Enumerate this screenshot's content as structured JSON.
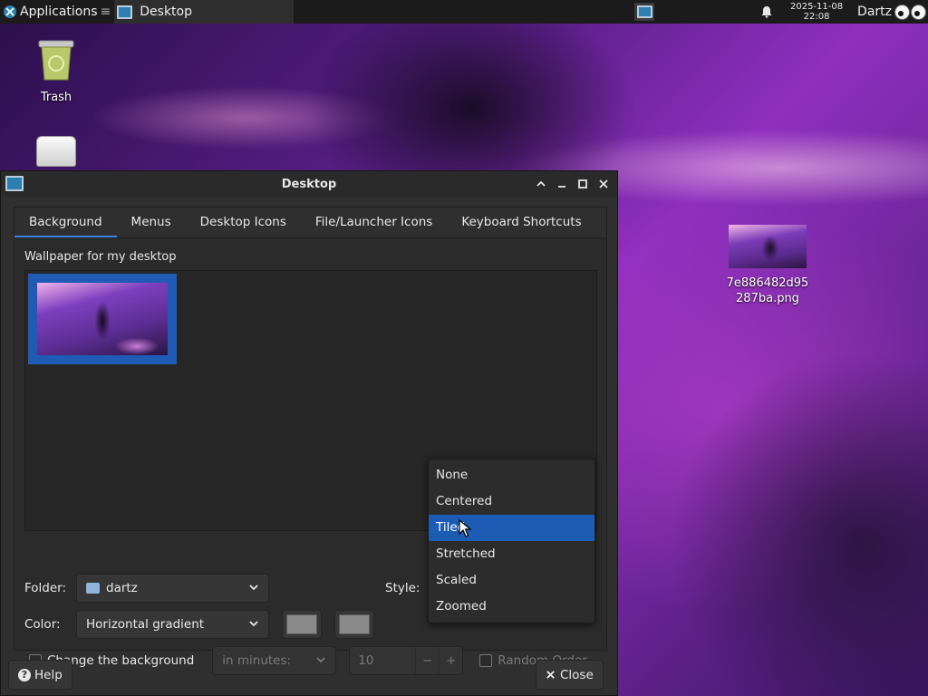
{
  "panel": {
    "applications_label": "Applications",
    "separator_glyph": "≡",
    "task_label": "Desktop",
    "clock_date": "2025-11-08",
    "clock_time": "22:08",
    "user_label": "Dartz"
  },
  "desktop_icons": {
    "trash_label": "Trash",
    "png_label_line1": "7e886482d95",
    "png_label_line2": "287ba.png"
  },
  "window": {
    "title": "Desktop",
    "tabs": [
      {
        "label": "Background",
        "active": true
      },
      {
        "label": "Menus",
        "active": false
      },
      {
        "label": "Desktop Icons",
        "active": false
      },
      {
        "label": "File/Launcher Icons",
        "active": false
      },
      {
        "label": "Keyboard Shortcuts",
        "active": false
      }
    ],
    "wallpaper_section_label": "Wallpaper for my desktop",
    "folder": {
      "label": "Folder:",
      "value": "dartz"
    },
    "style": {
      "label": "Style:",
      "options": [
        "None",
        "Centered",
        "Tiled",
        "Stretched",
        "Scaled",
        "Zoomed"
      ],
      "selected": "Tiled"
    },
    "color": {
      "label": "Color:",
      "value": "Horizontal gradient"
    },
    "change_background": {
      "label": "Change the background",
      "checked": false,
      "interval_unit": "in minutes:",
      "interval_value": "10",
      "minus": "−",
      "plus": "+",
      "random_order_label": "Random Order"
    },
    "help_label": "Help",
    "close_label": "Close"
  },
  "colors": {
    "accent": "#1c5cb4",
    "tab_underline": "#3d84e6",
    "window_bg": "#2f2f2f",
    "panel_bg": "#1b1b1b"
  }
}
